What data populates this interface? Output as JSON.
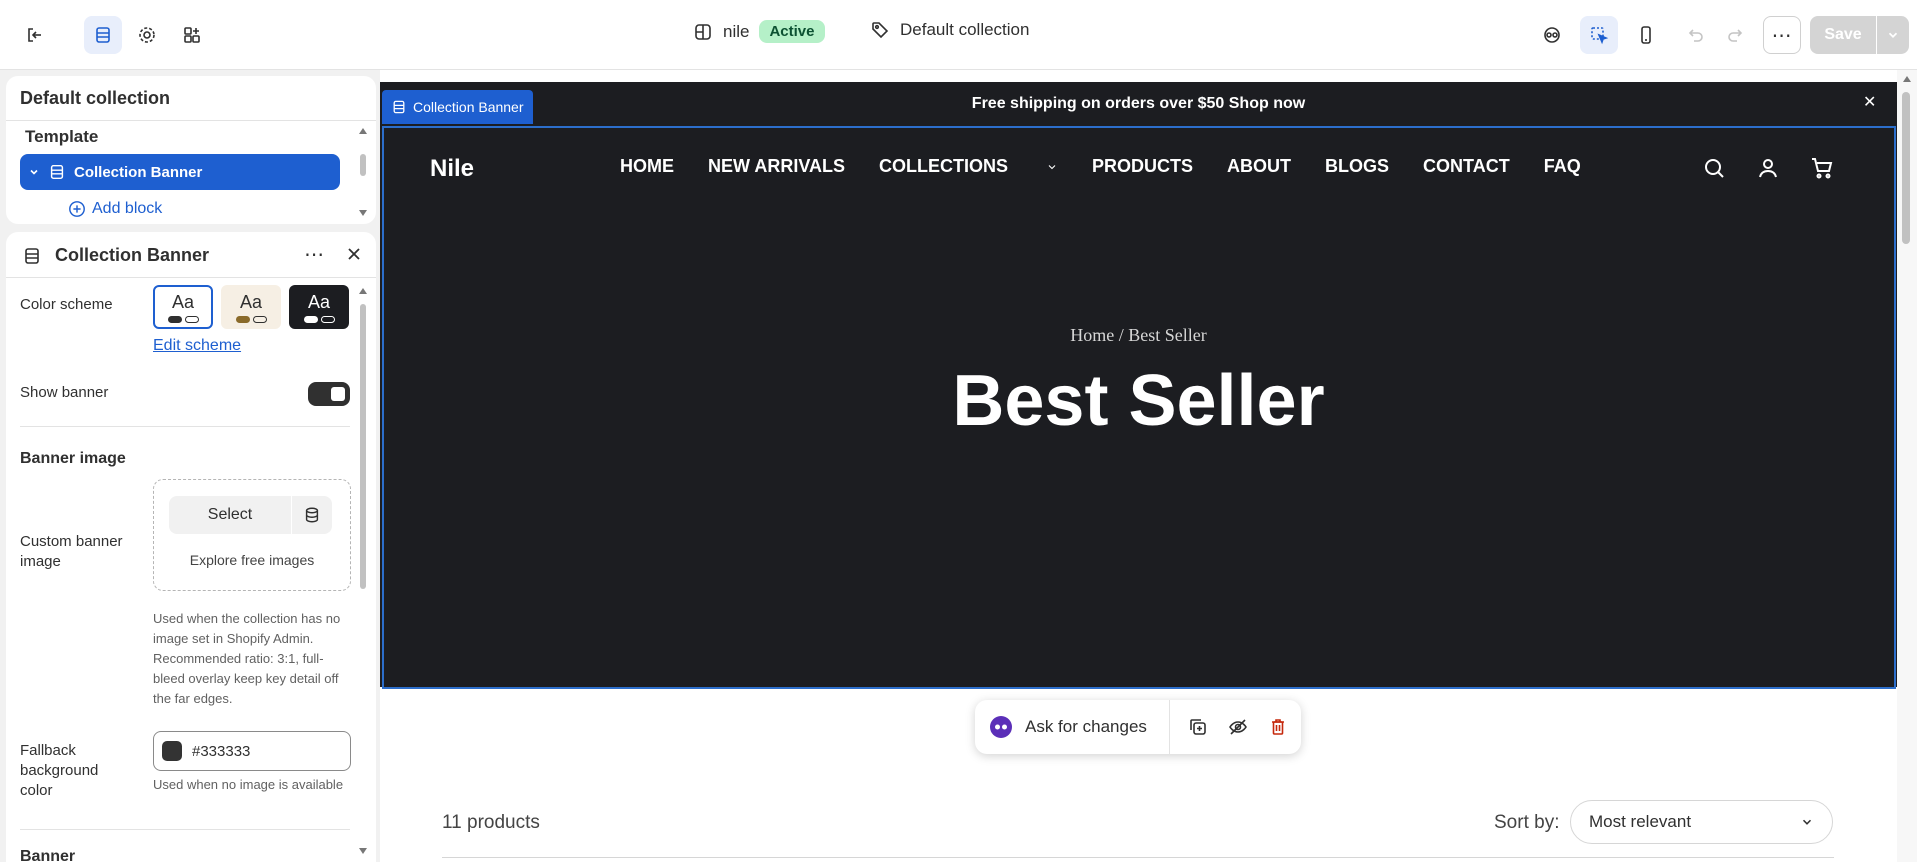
{
  "topbar": {
    "store_name": "nile",
    "status_badge": "Active",
    "template_name": "Default collection",
    "save_label": "Save"
  },
  "sections_panel": {
    "title": "Default collection",
    "group_label": "Template",
    "selected_item": "Collection Banner",
    "add_block_label": "Add block"
  },
  "settings_panel": {
    "title": "Collection Banner",
    "color_scheme_label": "Color scheme",
    "schemes": [
      "Aa",
      "Aa",
      "Aa"
    ],
    "edit_scheme_link": "Edit scheme",
    "show_banner_label": "Show banner",
    "banner_image_heading": "Banner image",
    "custom_banner_label": "Custom banner image",
    "select_button": "Select",
    "explore_link": "Explore free images",
    "custom_banner_help": "Used when the collection has no image set in Shopify Admin. Recommended ratio: 3:1, full-bleed overlay keep key detail off the far edges.",
    "fallback_label": "Fallback background color",
    "fallback_value": "#333333",
    "fallback_help": "Used when no image is available",
    "next_heading_partial": "Banner"
  },
  "preview": {
    "announcement": "Free shipping on orders over $50 Shop now",
    "section_tag": "Collection Banner",
    "logo": "Nile",
    "nav": [
      "HOME",
      "NEW ARRIVALS",
      "COLLECTIONS",
      "PRODUCTS",
      "ABOUT",
      "BLOGS",
      "CONTACT",
      "FAQ"
    ],
    "breadcrumb": "Home / Best Seller",
    "title": "Best Seller",
    "ask_label": "Ask for changes",
    "product_count": "11 products",
    "sort_label": "Sort by:",
    "sort_value": "Most relevant"
  },
  "colors": {
    "accent": "#1e5fd0",
    "banner_bg": "#1c1d21",
    "status_green": "#b5f0c8",
    "fallback_swatch": "#333333"
  }
}
